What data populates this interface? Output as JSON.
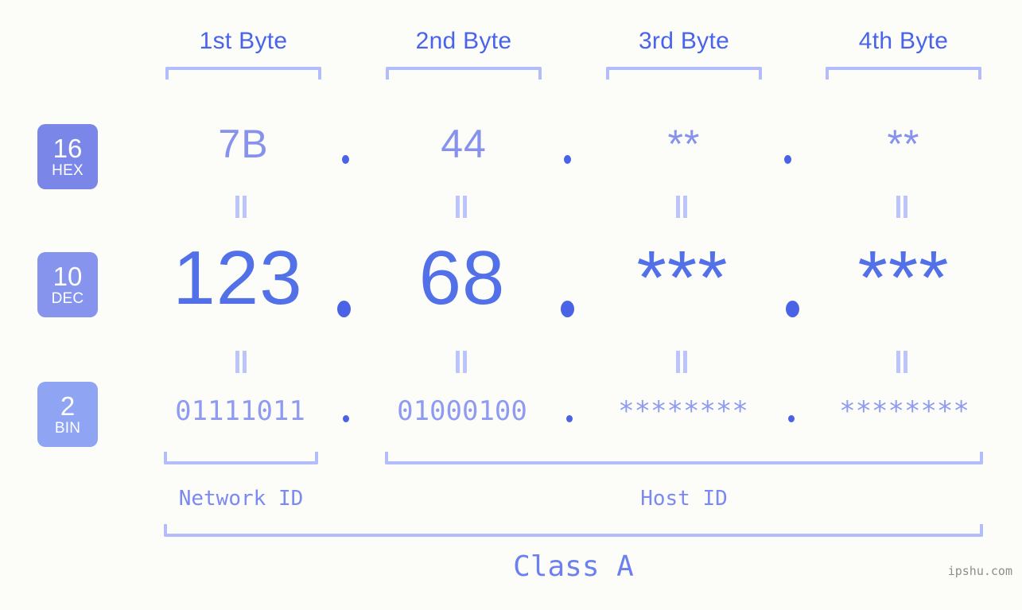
{
  "meta": {
    "background_color": "#fcfdf9",
    "accent_color": "#5271e8",
    "light_accent_color": "#b3bdfb",
    "badge_color": "#7b87e8",
    "watermark": "ipshu.com"
  },
  "byte_headers": [
    {
      "label": "1st Byte"
    },
    {
      "label": "2nd Byte"
    },
    {
      "label": "3rd Byte"
    },
    {
      "label": "4th Byte"
    }
  ],
  "rows": [
    {
      "key": "hex",
      "badge_number": "16",
      "badge_name": "HEX",
      "badge_color": "#7b87e8",
      "values": [
        "7B",
        "44",
        "**",
        "**"
      ],
      "separator": "."
    },
    {
      "key": "dec",
      "badge_number": "10",
      "badge_name": "DEC",
      "badge_color": "#8694ee",
      "values": [
        "123",
        "68",
        "***",
        "***"
      ],
      "separator": "."
    },
    {
      "key": "bin",
      "badge_number": "2",
      "badge_name": "BIN",
      "badge_color": "#8fa5f4",
      "values": [
        "01111011",
        "01000100",
        "********",
        "********"
      ],
      "separator": "."
    }
  ],
  "equality_marker": "=",
  "segments": {
    "network_id": "Network ID",
    "host_id": "Host ID"
  },
  "class_label": "Class A"
}
